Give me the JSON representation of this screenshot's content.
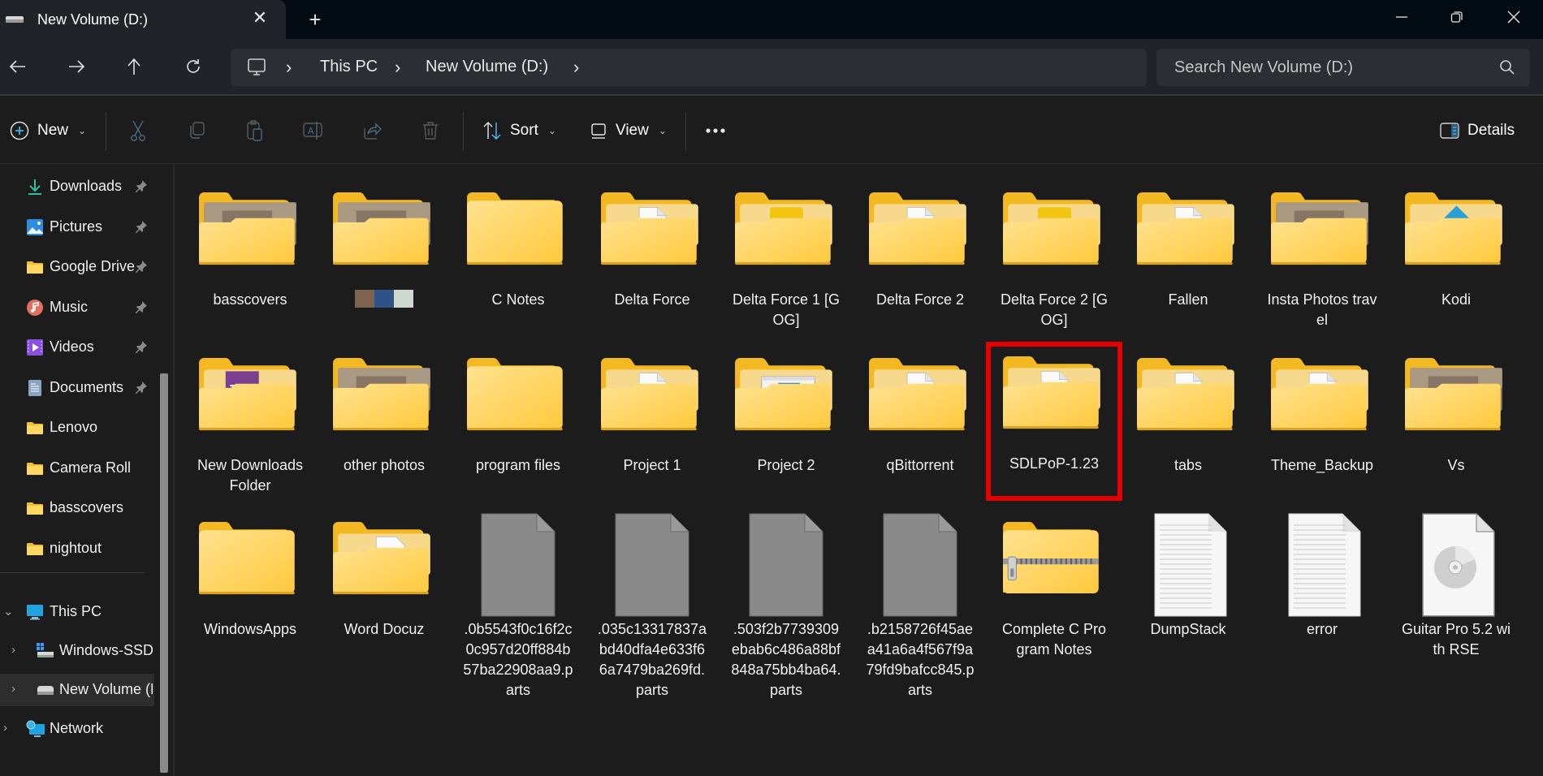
{
  "window": {
    "tab_title": "New Volume (D:)",
    "tab_close_icon": "close-icon",
    "new_tab_icon": "plus-icon"
  },
  "navigation": {
    "back": "arrow-left-icon",
    "forward": "arrow-right-icon",
    "up": "arrow-up-icon",
    "refresh": "refresh-icon"
  },
  "address_bar": {
    "breadcrumbs": [
      "This PC",
      "New Volume (D:)"
    ]
  },
  "search": {
    "placeholder": "Search New Volume (D:)"
  },
  "toolbar": {
    "new_label": "New",
    "sort_label": "Sort",
    "view_label": "View",
    "details_label": "Details",
    "icons": [
      "cut-icon",
      "copy-icon",
      "paste-icon",
      "rename-icon",
      "share-icon",
      "delete-icon"
    ]
  },
  "sidebar": {
    "quick_access": [
      {
        "label": "Downloads",
        "icon": "download-icon",
        "pinned": true
      },
      {
        "label": "Pictures",
        "icon": "pictures-icon",
        "pinned": true
      },
      {
        "label": "Google Drive",
        "icon": "folder-icon",
        "pinned": true
      },
      {
        "label": "Music",
        "icon": "music-icon",
        "pinned": true
      },
      {
        "label": "Videos",
        "icon": "videos-icon",
        "pinned": true
      },
      {
        "label": "Documents",
        "icon": "documents-icon",
        "pinned": true
      },
      {
        "label": "Lenovo",
        "icon": "folder-icon",
        "pinned": false
      },
      {
        "label": "Camera Roll",
        "icon": "folder-icon",
        "pinned": false
      },
      {
        "label": "basscovers",
        "icon": "folder-icon",
        "pinned": false
      },
      {
        "label": "nightout",
        "icon": "folder-icon",
        "pinned": false
      }
    ],
    "tree": [
      {
        "label": "This PC",
        "icon": "computer-icon",
        "expanded": true
      },
      {
        "label": "Windows-SSD",
        "icon": "windows-drive-icon",
        "expanded": false
      },
      {
        "label": "New Volume (D:)",
        "icon": "drive-icon",
        "expanded": false,
        "selected": true
      },
      {
        "label": "Network",
        "icon": "network-icon",
        "expanded": false
      }
    ]
  },
  "files": [
    {
      "name": "basscovers",
      "type": "folder",
      "preview": "photo"
    },
    {
      "name": "",
      "type": "folder",
      "preview": "photo",
      "name_swatches": [
        "#7d6450",
        "#2f5289",
        "#cfd8cc"
      ]
    },
    {
      "name": "C Notes",
      "type": "folder",
      "preview": "empty"
    },
    {
      "name": "Delta Force",
      "type": "folder",
      "preview": "doc"
    },
    {
      "name": "Delta Force 1 [GOG]",
      "type": "folder",
      "preview": "disc"
    },
    {
      "name": "Delta Force 2",
      "type": "folder",
      "preview": "doc"
    },
    {
      "name": "Delta Force 2 [GOG]",
      "type": "folder",
      "preview": "disc"
    },
    {
      "name": "Fallen",
      "type": "folder",
      "preview": "doc"
    },
    {
      "name": "Insta Photos travel",
      "type": "folder",
      "preview": "photo"
    },
    {
      "name": "Kodi",
      "type": "folder",
      "preview": "kodi"
    },
    {
      "name": "New Downloads Folder",
      "type": "folder",
      "preview": "app"
    },
    {
      "name": "other photos",
      "type": "folder",
      "preview": "photo"
    },
    {
      "name": "program files",
      "type": "folder",
      "preview": "empty"
    },
    {
      "name": "Project 1",
      "type": "folder",
      "preview": "doc"
    },
    {
      "name": "Project 2",
      "type": "folder",
      "preview": "window"
    },
    {
      "name": "qBittorrent",
      "type": "folder",
      "preview": "doc"
    },
    {
      "name": "SDLPoP-1.23",
      "type": "folder",
      "preview": "doc",
      "highlighted": true
    },
    {
      "name": "tabs",
      "type": "folder",
      "preview": "doc"
    },
    {
      "name": "Theme_Backup",
      "type": "folder",
      "preview": "doc"
    },
    {
      "name": "Vs",
      "type": "folder",
      "preview": "photo"
    },
    {
      "name": "WindowsApps",
      "type": "folder",
      "preview": "empty"
    },
    {
      "name": "Word Docuz",
      "type": "folder",
      "preview": "word"
    },
    {
      "name": ".0b5543f0c16f2c0c957d20ff884b57ba22908aa9.parts",
      "type": "file-generic"
    },
    {
      "name": ".035c13317837abd40dfa4e633f66a7479ba269fd.parts",
      "type": "file-generic"
    },
    {
      "name": ".503f2b7739309ebab6c486a88bf848a75bb4ba64.parts",
      "type": "file-generic"
    },
    {
      "name": ".b2158726f45aea41a6a4f567f9a79fd9bafcc845.parts",
      "type": "file-generic"
    },
    {
      "name": "Complete C Program Notes",
      "type": "zip"
    },
    {
      "name": "DumpStack",
      "type": "text"
    },
    {
      "name": "error",
      "type": "text"
    },
    {
      "name": "Guitar Pro 5.2 with RSE",
      "type": "disc-image"
    }
  ],
  "colors": {
    "highlight": "#e40000",
    "folder": "#ffd35c",
    "accent": "#4cc2ff"
  }
}
